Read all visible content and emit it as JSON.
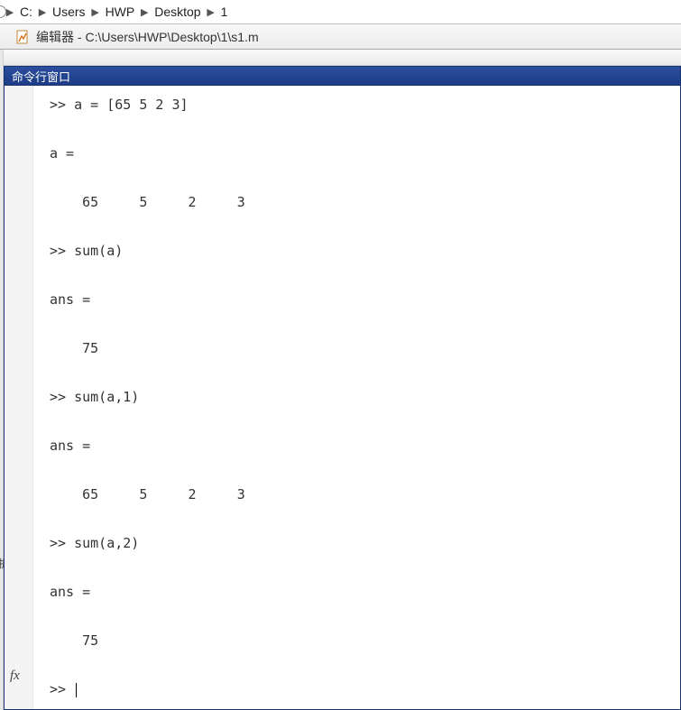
{
  "breadcrumb": {
    "items": [
      "C:",
      "Users",
      "HWP",
      "Desktop",
      "1"
    ]
  },
  "editor": {
    "label": "编辑器",
    "path": "C:\\Users\\HWP\\Desktop\\1\\s1.m"
  },
  "panel": {
    "title": "命令行窗口"
  },
  "console": {
    "lines": [
      ">> a = [65 5 2 3]",
      "",
      "a =",
      "",
      "    65     5     2     3",
      "",
      ">> sum(a)",
      "",
      "ans =",
      "",
      "    75",
      "",
      ">> sum(a,1)",
      "",
      "ans =",
      "",
      "    65     5     2     3",
      "",
      ">> sum(a,2)",
      "",
      "ans =",
      "",
      "    75",
      "",
      ">> "
    ]
  },
  "fx": "fx",
  "left_marker": "折"
}
